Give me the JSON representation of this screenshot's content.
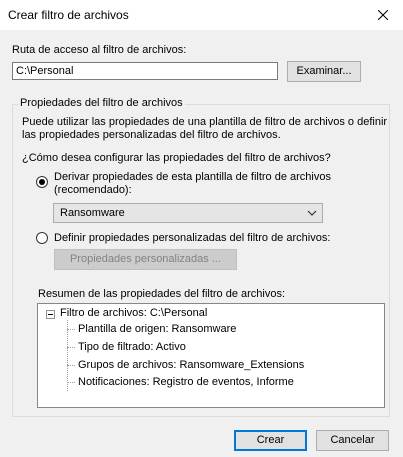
{
  "window": {
    "title": "Crear filtro de archivos"
  },
  "path": {
    "label": "Ruta de acceso al filtro de archivos:",
    "value": "C:\\Personal",
    "browse_label": "Examinar..."
  },
  "props": {
    "legend": "Propiedades del filtro de archivos",
    "description_line1": "Puede utilizar las propiedades de una plantilla de filtro de archivos o definir",
    "description_line2": "las propiedades personalizadas del filtro de archivos.",
    "question": "¿Cómo desea configurar las propiedades del filtro de archivos?",
    "option_template_line1": "Derivar propiedades de esta plantilla de filtro de archivos",
    "option_template_line2": "(recomendado):",
    "template_selected": "Ransomware",
    "option_custom": "Definir propiedades personalizadas del filtro de archivos:",
    "custom_button": "Propiedades personalizadas ..."
  },
  "summary": {
    "label": "Resumen de las propiedades del filtro de archivos:",
    "root": "Filtro de archivos: C:\\Personal",
    "items": [
      "Plantilla de origen: Ransomware",
      "Tipo de filtrado: Activo",
      "Grupos de archivos: Ransomware_Extensions",
      "Notificaciones: Registro de eventos, Informe"
    ]
  },
  "footer": {
    "create_label": "Crear",
    "cancel_label": "Cancelar"
  }
}
